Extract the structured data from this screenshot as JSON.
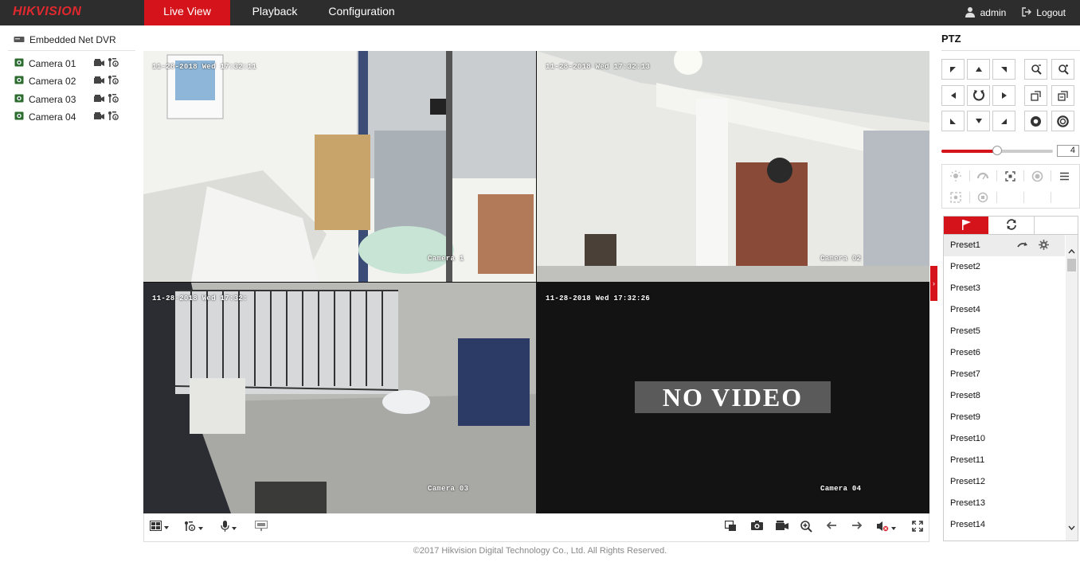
{
  "brand": {
    "logo": "HIKVISION",
    "accent": "#d4141a"
  },
  "nav": {
    "tabs": [
      {
        "label": "Live View",
        "active": true
      },
      {
        "label": "Playback",
        "active": false
      },
      {
        "label": "Configuration",
        "active": false
      }
    ],
    "user": "admin",
    "logout": "Logout"
  },
  "device_tree": {
    "device": "Embedded Net DVR",
    "cameras": [
      "Camera 01",
      "Camera 02",
      "Camera 03",
      "Camera 04"
    ]
  },
  "video": {
    "tiles": [
      {
        "timestamp": "11-28-2018 Wed 17:32:11",
        "name": "Camera 1",
        "selected": true
      },
      {
        "timestamp": "11-28-2018 Wed 17:32:13",
        "name": "Camera 02",
        "selected": false
      },
      {
        "timestamp": "11-28-2018 Wed 17:32:",
        "name": "Camera 03",
        "selected": false
      },
      {
        "timestamp": "11-28-2018 Wed 17:32:26",
        "name": "Camera 04",
        "selected": false,
        "no_video": "NO VIDEO"
      }
    ]
  },
  "toolbar": {
    "left_icons": [
      "layout-grid-icon",
      "stream-type-icon",
      "microphone-icon",
      "digital-zoom-icon"
    ],
    "right_icons": [
      "stop-all-icon",
      "capture-icon",
      "record-icon",
      "zoom-in-icon",
      "previous-page-icon",
      "next-page-icon",
      "mute-icon",
      "fullscreen-icon"
    ]
  },
  "ptz": {
    "title": "PTZ",
    "speed": "4",
    "speed_fraction": 0.5,
    "presets": [
      "Preset1",
      "Preset2",
      "Preset3",
      "Preset4",
      "Preset5",
      "Preset6",
      "Preset7",
      "Preset8",
      "Preset9",
      "Preset10",
      "Preset11",
      "Preset12",
      "Preset13",
      "Preset14"
    ]
  },
  "footer": "©2017 Hikvision Digital Technology Co., Ltd. All Rights Reserved."
}
